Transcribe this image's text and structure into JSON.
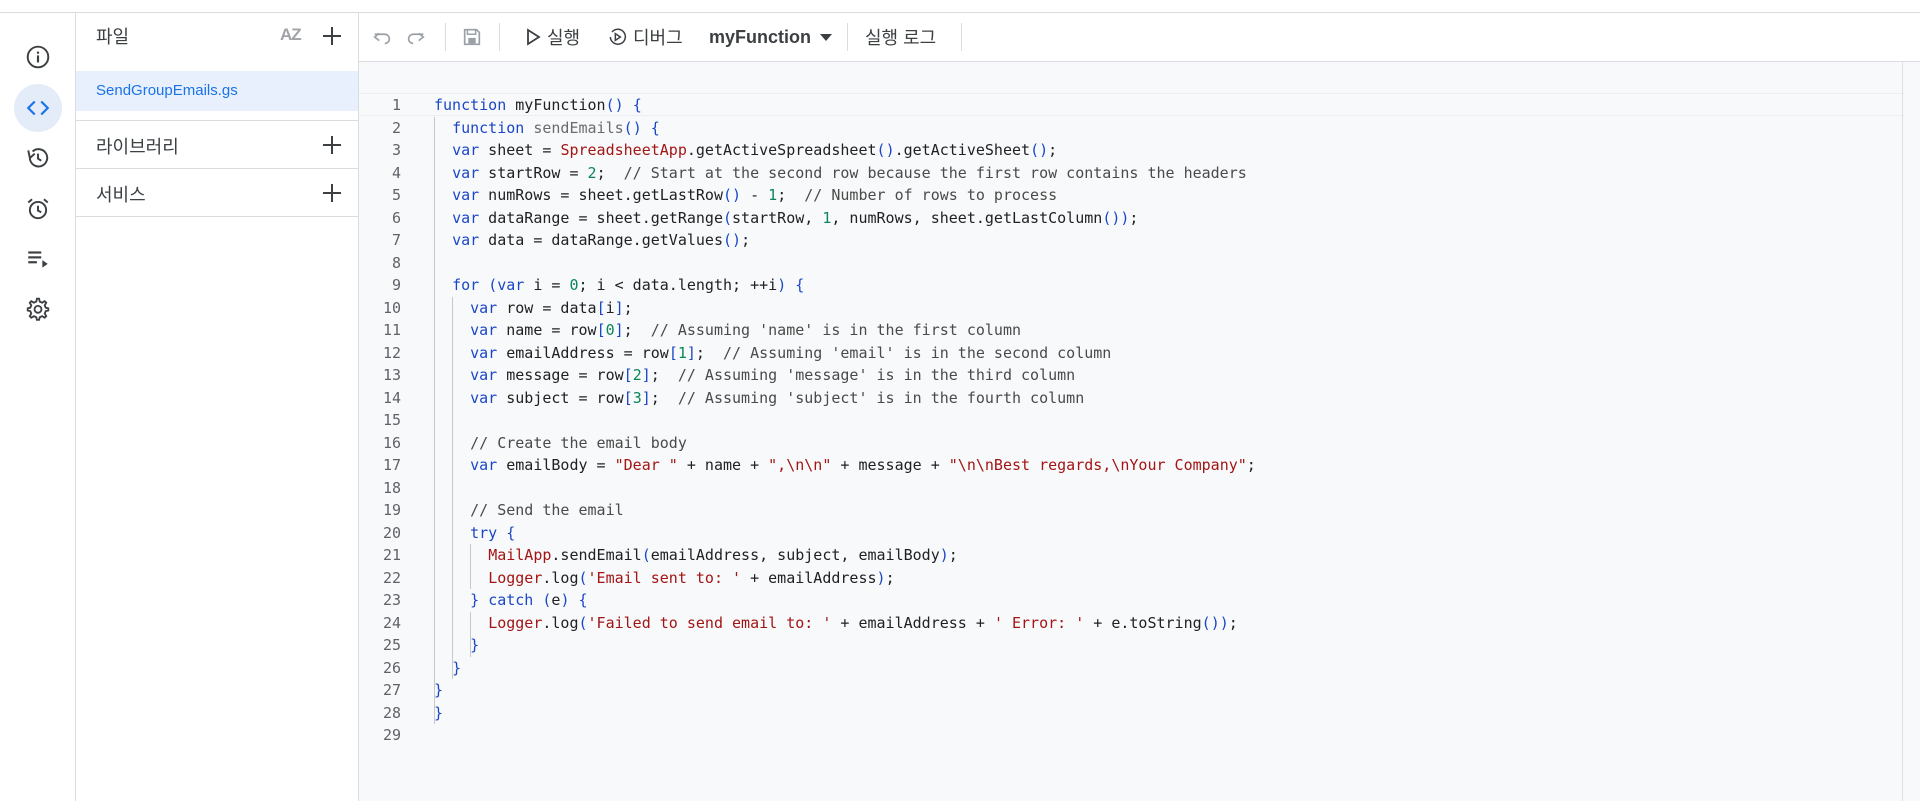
{
  "rail": {
    "items": [
      "info-icon",
      "code-icon",
      "history-icon",
      "alarm-icon",
      "executions-icon",
      "settings-icon"
    ],
    "active": "code-icon"
  },
  "files_panel": {
    "title": "파일",
    "sort_icon": "AZ",
    "files": [
      "SendGroupEmails.gs"
    ],
    "sections": [
      {
        "label": "라이브러리"
      },
      {
        "label": "서비스"
      }
    ]
  },
  "toolbar": {
    "run_label": "실행",
    "debug_label": "디버그",
    "function_select": "myFunction",
    "log_label": "실행 로그"
  },
  "colors": {
    "accent": "#1a73e8",
    "active_file_bg": "#e8f0fe",
    "keyword": "#1a46c8",
    "string": "#a31515",
    "number": "#098658"
  },
  "editor": {
    "lines": [
      "function myFunction() {",
      "  function sendEmails() {",
      "  var sheet = SpreadsheetApp.getActiveSpreadsheet().getActiveSheet();",
      "  var startRow = 2;  // Start at the second row because the first row contains the headers",
      "  var numRows = sheet.getLastRow() - 1;  // Number of rows to process",
      "  var dataRange = sheet.getRange(startRow, 1, numRows, sheet.getLastColumn());",
      "  var data = dataRange.getValues();",
      "",
      "  for (var i = 0; i < data.length; ++i) {",
      "    var row = data[i];",
      "    var name = row[0];  // Assuming 'name' is in the first column",
      "    var emailAddress = row[1];  // Assuming 'email' is in the second column",
      "    var message = row[2];  // Assuming 'message' is in the third column",
      "    var subject = row[3];  // Assuming 'subject' is in the fourth column",
      "",
      "    // Create the email body",
      "    var emailBody = \"Dear \" + name + \",\\n\\n\" + message + \"\\n\\nBest regards,\\nYour Company\";",
      "",
      "    // Send the email",
      "    try {",
      "      MailApp.sendEmail(emailAddress, subject, emailBody);",
      "      Logger.log('Email sent to: ' + emailAddress);",
      "    } catch (e) {",
      "      Logger.log('Failed to send email to: ' + emailAddress + ' Error: ' + e.toString());",
      "    }",
      "  }",
      "}",
      "}",
      ""
    ]
  }
}
